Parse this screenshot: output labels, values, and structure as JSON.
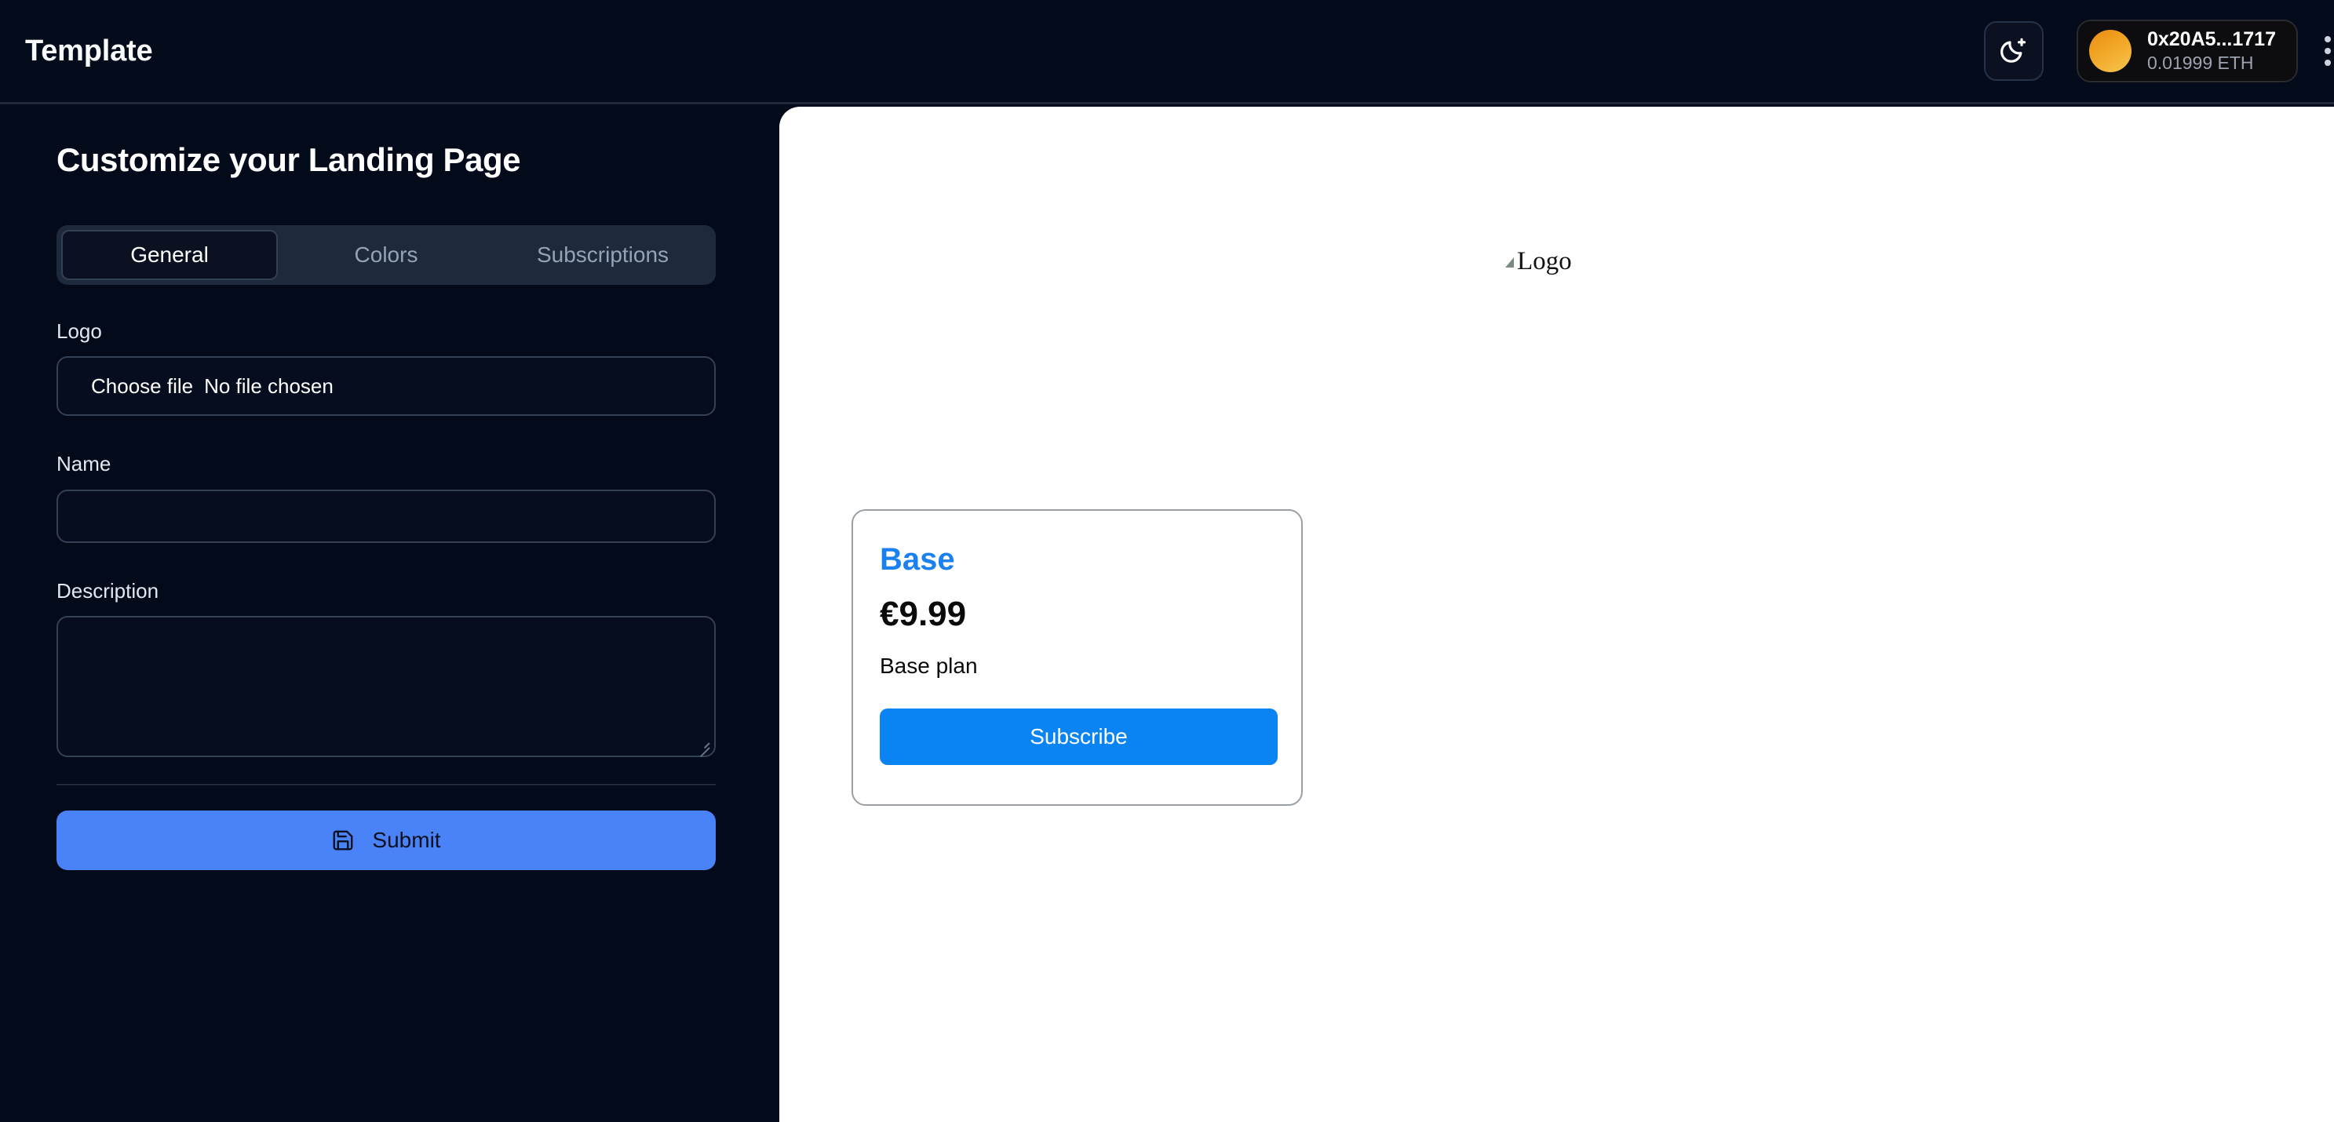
{
  "header": {
    "brand_title": "Template",
    "theme_toggle_icon": "moon-icon",
    "wallet": {
      "avatar_icon": "wallet-avatar",
      "address": "0x20A5...1717",
      "balance": "0.01999 ETH"
    },
    "overflow_menu_icon": "kebab-menu-icon"
  },
  "sidebar": {
    "panel_title": "Customize your Landing Page",
    "tabs": [
      {
        "label": "General",
        "active": true
      },
      {
        "label": "Colors",
        "active": false
      },
      {
        "label": "Subscriptions",
        "active": false
      }
    ],
    "fields": {
      "logo_label": "Logo",
      "logo_button_label": "Choose file",
      "logo_file_state": "No file chosen",
      "name_label": "Name",
      "name_value": "",
      "name_placeholder": "",
      "description_label": "Description",
      "description_value": "",
      "description_placeholder": ""
    },
    "submit": {
      "label": "Submit",
      "icon": "save-icon"
    }
  },
  "preview": {
    "logo": {
      "alt_text": "Logo",
      "icon": "broken-image-icon"
    },
    "pricing_card": {
      "plan_name": "Base",
      "price": "€9.99",
      "description": "Base plan",
      "cta_label": "Subscribe"
    }
  },
  "colors": {
    "app_background": "#030a1a",
    "header_background": "#040b1b",
    "header_border": "#1e293b",
    "tabstrip_background": "#1e293b",
    "tab_active_background": "#0b1120",
    "input_border": "#334155",
    "submit_button": "#4a82f7",
    "preview_background": "#ffffff",
    "plan_accent": "#1b81f0",
    "subscribe_button": "#0a84f2",
    "avatar_gradient_start": "#e98a18",
    "avatar_gradient_end": "#f7c64e"
  }
}
